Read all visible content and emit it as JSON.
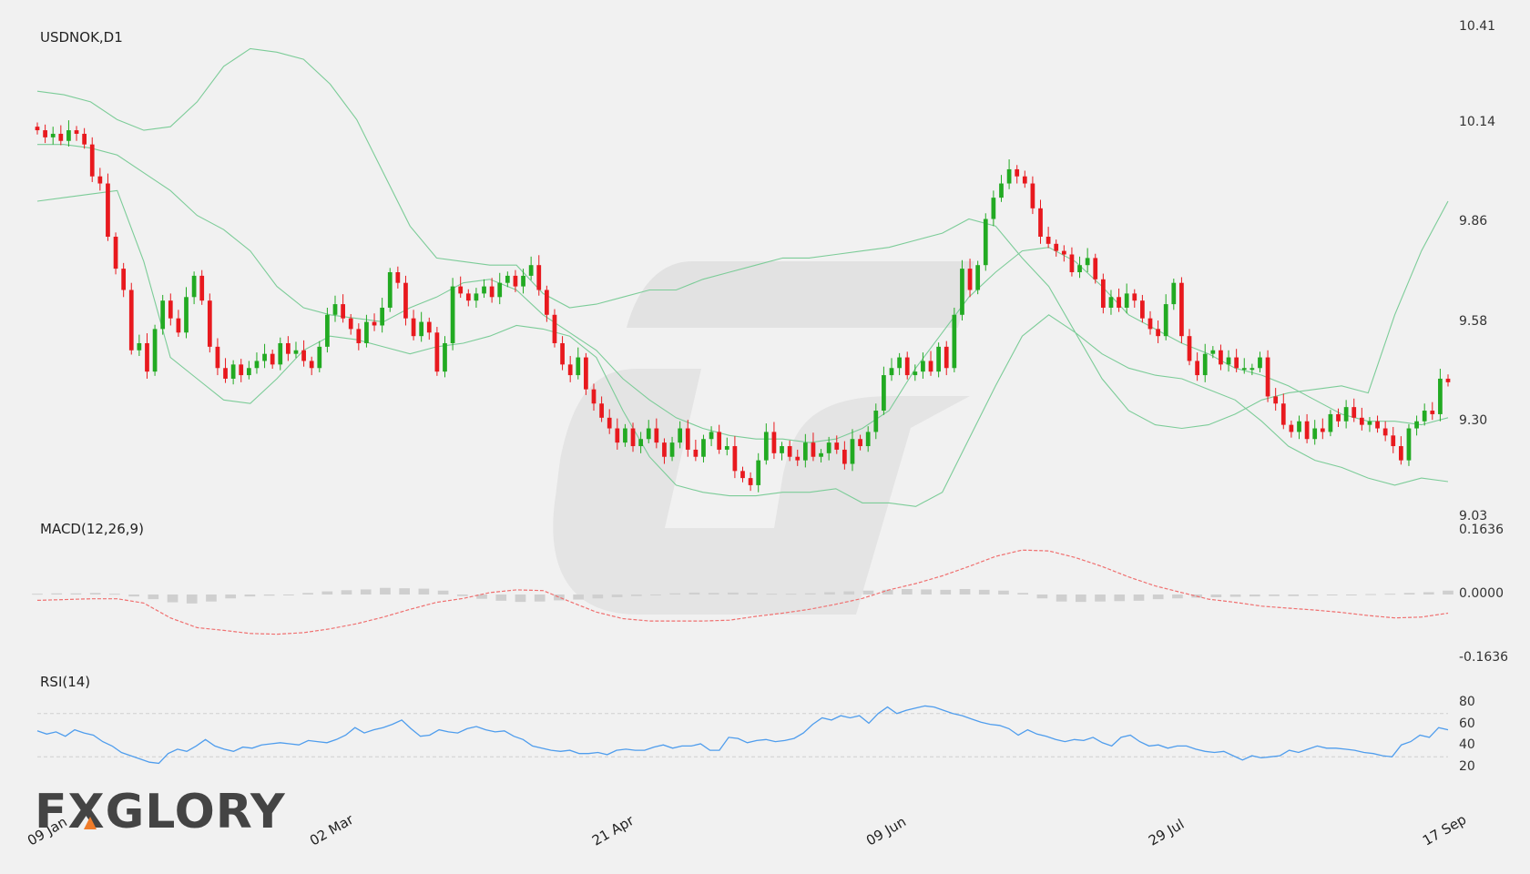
{
  "chart_data": {
    "type": "candlestick",
    "symbol": "USDNOK,D1",
    "colors": {
      "up": "#22aa22",
      "down": "#e8191e",
      "bollinger": "#7ccc98",
      "macd_signal": "#f07070",
      "macd_hist": "#cfcfcf",
      "rsi": "#4f9ded",
      "grid": "#cfcfcf"
    },
    "price_axis": {
      "ticks": [
        "10.41",
        "10.14",
        "9.86",
        "9.58",
        "9.30",
        "9.03"
      ],
      "ylim": [
        9.03,
        10.41
      ]
    },
    "x_ticks": [
      {
        "index": 0,
        "label": "09 Jan"
      },
      {
        "index": 36,
        "label": "02 Mar"
      },
      {
        "index": 72,
        "label": "21 Apr"
      },
      {
        "index": 107,
        "label": "09 Jun"
      },
      {
        "index": 143,
        "label": "29 Jul"
      },
      {
        "index": 178,
        "label": "17 Sep"
      }
    ],
    "closes": [
      10.12,
      10.1,
      10.11,
      10.09,
      10.12,
      10.11,
      10.08,
      9.99,
      9.97,
      9.82,
      9.73,
      9.67,
      9.5,
      9.52,
      9.44,
      9.56,
      9.64,
      9.59,
      9.55,
      9.65,
      9.71,
      9.64,
      9.51,
      9.45,
      9.42,
      9.46,
      9.43,
      9.45,
      9.47,
      9.49,
      9.46,
      9.52,
      9.49,
      9.5,
      9.47,
      9.45,
      9.51,
      9.6,
      9.63,
      9.59,
      9.56,
      9.52,
      9.58,
      9.57,
      9.62,
      9.72,
      9.69,
      9.59,
      9.54,
      9.58,
      9.55,
      9.44,
      9.52,
      9.68,
      9.66,
      9.64,
      9.66,
      9.68,
      9.65,
      9.69,
      9.71,
      9.68,
      9.71,
      9.74,
      9.67,
      9.6,
      9.52,
      9.46,
      9.43,
      9.48,
      9.39,
      9.35,
      9.31,
      9.28,
      9.24,
      9.28,
      9.23,
      9.25,
      9.28,
      9.24,
      9.2,
      9.24,
      9.28,
      9.22,
      9.2,
      9.25,
      9.27,
      9.22,
      9.23,
      9.16,
      9.14,
      9.12,
      9.19,
      9.27,
      9.21,
      9.23,
      9.2,
      9.19,
      9.24,
      9.2,
      9.21,
      9.24,
      9.22,
      9.18,
      9.25,
      9.23,
      9.27,
      9.33,
      9.43,
      9.45,
      9.48,
      9.43,
      9.44,
      9.47,
      9.44,
      9.51,
      9.45,
      9.6,
      9.73,
      9.67,
      9.74,
      9.87,
      9.93,
      9.97,
      10.01,
      9.99,
      9.97,
      9.9,
      9.82,
      9.8,
      9.78,
      9.77,
      9.72,
      9.74,
      9.76,
      9.7,
      9.62,
      9.65,
      9.62,
      9.66,
      9.64,
      9.59,
      9.56,
      9.54,
      9.63,
      9.69,
      9.54,
      9.47,
      9.43,
      9.49,
      9.5,
      9.46,
      9.48,
      9.45,
      9.45,
      9.45,
      9.48,
      9.37,
      9.35,
      9.29,
      9.27,
      9.3,
      9.25,
      9.28,
      9.27,
      9.32,
      9.3,
      9.34,
      9.31,
      9.29,
      9.3,
      9.28,
      9.26,
      9.23,
      9.19,
      9.28,
      9.3,
      9.33,
      9.32,
      9.42,
      9.41
    ],
    "bollinger": {
      "upper": [
        10.23,
        10.22,
        10.2,
        10.15,
        10.12,
        10.13,
        10.2,
        10.3,
        10.35,
        10.34,
        10.32,
        10.25,
        10.15,
        10.0,
        9.85,
        9.76,
        9.75,
        9.74,
        9.74,
        9.66,
        9.62,
        9.63,
        9.65,
        9.67,
        9.67,
        9.7,
        9.72,
        9.74,
        9.76,
        9.76,
        9.77,
        9.78,
        9.79,
        9.81,
        9.83,
        9.87,
        9.85,
        9.76,
        9.68,
        9.55,
        9.42,
        9.33,
        9.29,
        9.28,
        9.29,
        9.32,
        9.36,
        9.38,
        9.39,
        9.4,
        9.38,
        9.6,
        9.78,
        9.92
      ],
      "mid": [
        10.08,
        10.08,
        10.07,
        10.05,
        10.0,
        9.95,
        9.88,
        9.84,
        9.78,
        9.68,
        9.62,
        9.6,
        9.59,
        9.58,
        9.62,
        9.65,
        9.69,
        9.7,
        9.67,
        9.6,
        9.55,
        9.5,
        9.42,
        9.36,
        9.31,
        9.28,
        9.26,
        9.25,
        9.25,
        9.24,
        9.25,
        9.28,
        9.33,
        9.45,
        9.55,
        9.65,
        9.72,
        9.78,
        9.79,
        9.75,
        9.68,
        9.6,
        9.56,
        9.52,
        9.49,
        9.45,
        9.43,
        9.4,
        9.36,
        9.32,
        9.3,
        9.3,
        9.29,
        9.31
      ],
      "lower": [
        9.92,
        9.93,
        9.94,
        9.95,
        9.75,
        9.48,
        9.42,
        9.36,
        9.35,
        9.42,
        9.5,
        9.54,
        9.53,
        9.51,
        9.49,
        9.51,
        9.52,
        9.54,
        9.57,
        9.56,
        9.54,
        9.48,
        9.33,
        9.2,
        9.12,
        9.1,
        9.09,
        9.09,
        9.1,
        9.1,
        9.11,
        9.07,
        9.07,
        9.06,
        9.1,
        9.25,
        9.4,
        9.54,
        9.6,
        9.55,
        9.49,
        9.45,
        9.43,
        9.42,
        9.39,
        9.36,
        9.3,
        9.23,
        9.19,
        9.17,
        9.14,
        9.12,
        9.14,
        9.13
      ]
    },
    "macd": {
      "label": "MACD(12,26,9)",
      "ticks": [
        "0.1636",
        "0.0000",
        "-0.1636"
      ],
      "ylim": [
        -0.1636,
        0.1636
      ],
      "hist": [
        0.002,
        0.003,
        0.003,
        0.004,
        0.002,
        -0.005,
        -0.012,
        -0.02,
        -0.023,
        -0.018,
        -0.01,
        -0.005,
        -0.003,
        -0.002,
        0.004,
        0.008,
        0.011,
        0.013,
        0.017,
        0.016,
        0.015,
        0.01,
        -0.004,
        -0.011,
        -0.016,
        -0.019,
        -0.018,
        -0.015,
        -0.013,
        -0.01,
        -0.007,
        -0.004,
        -0.002,
        0.003,
        0.005,
        0.004,
        0.005,
        0.004,
        0.002,
        0.002,
        0.003,
        0.006,
        0.008,
        0.01,
        0.012,
        0.014,
        0.013,
        0.012,
        0.014,
        0.012,
        0.01,
        0.004,
        -0.01,
        -0.018,
        -0.019,
        -0.018,
        -0.017,
        -0.016,
        -0.012,
        -0.01,
        -0.008,
        -0.007,
        -0.006,
        -0.005,
        -0.004,
        -0.004,
        -0.003,
        -0.002,
        0.0,
        0.001,
        0.002,
        0.004,
        0.006,
        0.01
      ],
      "signal": [
        -0.015,
        -0.013,
        -0.011,
        -0.011,
        -0.022,
        -0.06,
        -0.085,
        -0.092,
        -0.1,
        -0.102,
        -0.098,
        -0.088,
        -0.075,
        -0.058,
        -0.038,
        -0.02,
        -0.01,
        0.005,
        0.012,
        0.01,
        -0.018,
        -0.045,
        -0.062,
        -0.068,
        -0.068,
        -0.068,
        -0.066,
        -0.056,
        -0.048,
        -0.038,
        -0.025,
        -0.01,
        0.012,
        0.028,
        0.048,
        0.072,
        0.098,
        0.114,
        0.112,
        0.095,
        0.072,
        0.045,
        0.022,
        0.005,
        -0.012,
        -0.02,
        -0.03,
        -0.035,
        -0.04,
        -0.046,
        -0.054,
        -0.06,
        -0.058,
        -0.048
      ]
    },
    "rsi": {
      "label": "RSI(14)",
      "ticks": [
        "80",
        "60",
        "40",
        "20"
      ],
      "levels": [
        70,
        30
      ],
      "ylim": [
        10,
        90
      ],
      "values": [
        54,
        51,
        53,
        49,
        55,
        52,
        50,
        44,
        40,
        34,
        31,
        28,
        25,
        24,
        33,
        37,
        35,
        40,
        46,
        40,
        37,
        35,
        39,
        38,
        41,
        42,
        43,
        42,
        41,
        45,
        44,
        43,
        46,
        50,
        57,
        52,
        55,
        57,
        60,
        64,
        56,
        49,
        50,
        55,
        53,
        52,
        56,
        58,
        55,
        53,
        54,
        49,
        46,
        40,
        38,
        36,
        35,
        36,
        33,
        33,
        34,
        32,
        36,
        37,
        36,
        36,
        39,
        41,
        38,
        40,
        40,
        42,
        36,
        36,
        48,
        47,
        43,
        45,
        46,
        44,
        45,
        47,
        52,
        60,
        66,
        64,
        68,
        66,
        68,
        61,
        70,
        76,
        70,
        73,
        75,
        77,
        76,
        73,
        70,
        68,
        65,
        62,
        60,
        59,
        56,
        50,
        55,
        51,
        49,
        46,
        44,
        46,
        45,
        48,
        43,
        40,
        48,
        50,
        44,
        40,
        41,
        38,
        40,
        40,
        37,
        35,
        34,
        35,
        31,
        27,
        31,
        29,
        30,
        31,
        36,
        34,
        37,
        40,
        38,
        38,
        37,
        36,
        34,
        33,
        31,
        30,
        41,
        44,
        50,
        48,
        57,
        55
      ]
    }
  },
  "brand": {
    "logo_text": "FXGLORY",
    "logo_accent": "#f07c2a"
  }
}
